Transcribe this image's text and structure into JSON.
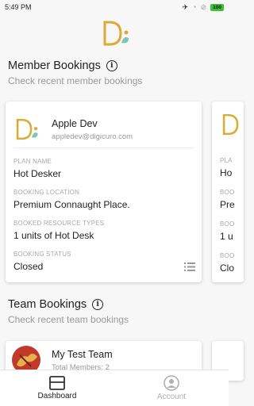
{
  "status_bar": {
    "time": "5:49 PM",
    "battery": "100"
  },
  "member_bookings": {
    "title": "Member Bookings",
    "subtitle": "Check recent member bookings",
    "card": {
      "name": "Apple Dev",
      "email": "appledev@digicuro.com",
      "fields": [
        {
          "label": "PLAN NAME",
          "value": "Hot Desker"
        },
        {
          "label": "BOOKING LOCATION",
          "value": "Premium Connaught Place."
        },
        {
          "label": "BOOKED RESOURCE TYPES",
          "value": "1 units of Hot Desk"
        },
        {
          "label": "BOOKING STATUS",
          "value": "Closed"
        }
      ]
    },
    "peek_card": {
      "fields": [
        {
          "label": "PLA",
          "value": "Ho"
        },
        {
          "label": "BOO",
          "value": "Pre"
        },
        {
          "label": "BOO",
          "value": "1 u"
        },
        {
          "label": "BOO",
          "value": "Clo"
        }
      ]
    }
  },
  "team_bookings": {
    "title": "Team Bookings",
    "subtitle": "Check recent team bookings",
    "card": {
      "name": "My Test Team",
      "members": "Total Members: 2"
    }
  },
  "bottom_nav": {
    "items": [
      {
        "label": "Dashboard",
        "icon": "dashboard-icon",
        "active": true
      },
      {
        "label": "Account",
        "icon": "account-icon",
        "active": false
      }
    ]
  },
  "colors": {
    "logo_gold": "#d9ac3a",
    "logo_teal": "#7fc4b8",
    "battery_green": "#3cc13b",
    "team_avatar": "#c0392b"
  }
}
